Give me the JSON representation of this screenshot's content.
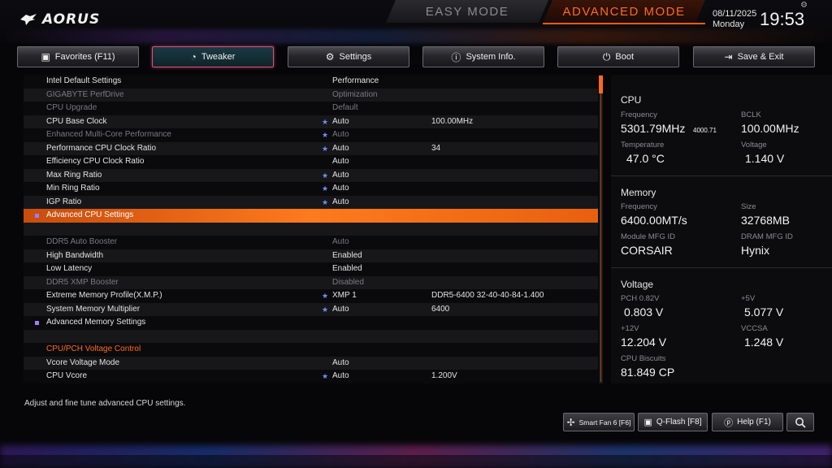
{
  "header": {
    "logo_text": "AORUS",
    "easy_mode_label": "EASY MODE",
    "advanced_mode_label": "ADVANCED MODE",
    "date": "08/11/2025",
    "day": "Monday",
    "time": "19:53"
  },
  "tabs": [
    {
      "label": "Favorites (F11)",
      "icon": "star-box-icon"
    },
    {
      "label": "Tweaker",
      "icon": "speedometer-icon",
      "active": true
    },
    {
      "label": "Settings",
      "icon": "gear-icon"
    },
    {
      "label": "System Info.",
      "icon": "info-icon"
    },
    {
      "label": "Boot",
      "icon": "power-icon"
    },
    {
      "label": "Save & Exit",
      "icon": "exit-icon"
    }
  ],
  "settings": [
    {
      "name": "Intel Default Settings",
      "value": "Performance",
      "current": "",
      "marked": false,
      "dim": false
    },
    {
      "name": "GIGABYTE PerfDrive",
      "value": "Optimization",
      "current": "",
      "marked": false,
      "dim": true
    },
    {
      "name": "CPU Upgrade",
      "value": "Default",
      "current": "",
      "marked": false,
      "dim": true
    },
    {
      "name": "CPU Base Clock",
      "value": "Auto",
      "current": "100.00MHz",
      "marked": true,
      "dim": false
    },
    {
      "name": "Enhanced Multi-Core Performance",
      "value": "Auto",
      "current": "",
      "marked": true,
      "dim": true
    },
    {
      "name": "Performance CPU Clock Ratio",
      "value": "Auto",
      "current": "34",
      "marked": true,
      "dim": false
    },
    {
      "name": "Efficiency CPU Clock Ratio",
      "value": "Auto",
      "current": "",
      "marked": false,
      "dim": false
    },
    {
      "name": "Max Ring Ratio",
      "value": "Auto",
      "current": "",
      "marked": true,
      "dim": false
    },
    {
      "name": "Min Ring Ratio",
      "value": "Auto",
      "current": "",
      "marked": true,
      "dim": false
    },
    {
      "name": "IGP Ratio",
      "value": "Auto",
      "current": "",
      "marked": true,
      "dim": false
    },
    {
      "name": "Advanced CPU Settings",
      "value": "",
      "current": "",
      "marked": false,
      "dim": false,
      "highlight": true,
      "submenu": true
    },
    {
      "name": "",
      "value": "",
      "current": "",
      "marked": false,
      "dim": false
    },
    {
      "name": "DDR5 Auto Booster",
      "value": "Auto",
      "current": "",
      "marked": false,
      "dim": true
    },
    {
      "name": "High Bandwidth",
      "value": "Enabled",
      "current": "",
      "marked": false,
      "dim": false
    },
    {
      "name": "Low Latency",
      "value": "Enabled",
      "current": "",
      "marked": false,
      "dim": false
    },
    {
      "name": "DDR5 XMP Booster",
      "value": "Disabled",
      "current": "",
      "marked": false,
      "dim": true
    },
    {
      "name": "Extreme Memory Profile(X.M.P.)",
      "value": "XMP 1",
      "current": "DDR5-6400 32-40-40-84-1.400",
      "marked": true,
      "dim": false
    },
    {
      "name": "System Memory Multiplier",
      "value": "Auto",
      "current": "6400",
      "marked": true,
      "dim": false
    },
    {
      "name": "Advanced Memory Settings",
      "value": "",
      "current": "",
      "marked": false,
      "dim": false,
      "submenu": true
    },
    {
      "name": "",
      "value": "",
      "current": "",
      "marked": false,
      "dim": false
    },
    {
      "name": "CPU/PCH Voltage Control",
      "value": "",
      "current": "",
      "marked": false,
      "dim": false,
      "section": true
    },
    {
      "name": "Vcore Voltage Mode",
      "value": "Auto",
      "current": "",
      "marked": false,
      "dim": false
    },
    {
      "name": "CPU Vcore",
      "value": "Auto",
      "current": "1.200V",
      "marked": true,
      "dim": false
    }
  ],
  "info": {
    "cpu": {
      "title": "CPU",
      "frequency_label": "Frequency",
      "frequency": "5301.79MHz",
      "frequency_sub": "4000.71",
      "bclk_label": "BCLK",
      "bclk": "100.00MHz",
      "temperature_label": "Temperature",
      "temperature": "47.0 °C",
      "voltage_label": "Voltage",
      "voltage": "1.140 V"
    },
    "memory": {
      "title": "Memory",
      "frequency_label": "Frequency",
      "frequency": "6400.00MT/s",
      "size_label": "Size",
      "size": "32768MB",
      "module_label": "Module MFG ID",
      "module": "CORSAIR",
      "dram_label": "DRAM MFG ID",
      "dram": "Hynix"
    },
    "voltage": {
      "title": "Voltage",
      "pch_label": "PCH 0.82V",
      "pch": "0.803 V",
      "v5_label": "+5V",
      "v5": "5.077 V",
      "v12_label": "+12V",
      "v12": "12.204 V",
      "vccsa_label": "VCCSA",
      "vccsa": "1.248 V",
      "biscuits_label": "CPU Biscuits",
      "biscuits": "81.849 CP"
    }
  },
  "footer": {
    "description": "Adjust and fine tune advanced CPU settings.",
    "smart_fan": "Smart Fan 6 [F6]",
    "qflash": "Q-Flash [F8]",
    "help": "Help (F1)"
  },
  "colors": {
    "accent": "#ff6a1a",
    "active_tab_border": "#e0507a",
    "marker": "#6f8fff"
  }
}
